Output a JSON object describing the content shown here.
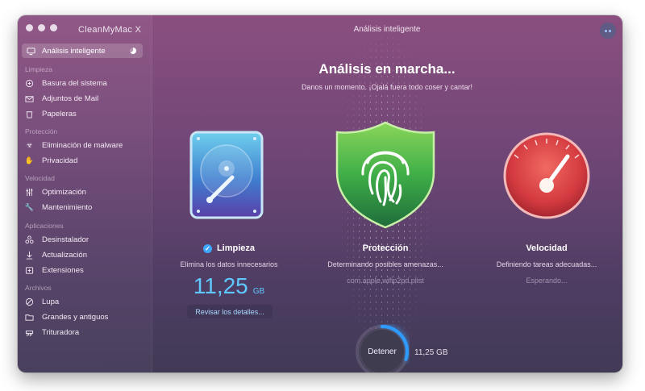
{
  "app": {
    "title": "CleanMyMac X",
    "window_title": "Análisis inteligente"
  },
  "sidebar": {
    "active": {
      "label": "Análisis inteligente",
      "icon": "monitor-icon"
    },
    "sections": [
      {
        "label": "Limpieza",
        "items": [
          {
            "label": "Basura del sistema",
            "icon": "system-junk-icon"
          },
          {
            "label": "Adjuntos de Mail",
            "icon": "mail-icon"
          },
          {
            "label": "Papeleras",
            "icon": "trash-icon"
          }
        ]
      },
      {
        "label": "Protección",
        "items": [
          {
            "label": "Eliminación de malware",
            "icon": "biohazard-icon"
          },
          {
            "label": "Privacidad",
            "icon": "hand-icon"
          }
        ]
      },
      {
        "label": "Velocidad",
        "items": [
          {
            "label": "Optimización",
            "icon": "sliders-icon"
          },
          {
            "label": "Mantenimiento",
            "icon": "wrench-icon"
          }
        ]
      },
      {
        "label": "Aplicaciones",
        "items": [
          {
            "label": "Desinstalador",
            "icon": "uninstaller-icon"
          },
          {
            "label": "Actualización",
            "icon": "update-icon"
          },
          {
            "label": "Extensiones",
            "icon": "extensions-icon"
          }
        ]
      },
      {
        "label": "Archivos",
        "items": [
          {
            "label": "Lupa",
            "icon": "lens-icon"
          },
          {
            "label": "Grandes y antiguos",
            "icon": "folder-icon"
          },
          {
            "label": "Trituradora",
            "icon": "shredder-icon"
          }
        ]
      }
    ]
  },
  "main": {
    "headline": "Análisis en marcha...",
    "subline": "Danos un momento. ¡Ojalá fuera todo coser y cantar!",
    "modules": [
      {
        "title": "Limpieza",
        "description": "Elimina los datos innecesarios",
        "icon": "hard-drive-icon",
        "done": true
      },
      {
        "title": "Protección",
        "description": "Determinando posibles amenazas...",
        "status": "com.apple.wifip2pd.plist",
        "icon": "fingerprint-shield-icon"
      },
      {
        "title": "Velocidad",
        "description": "Definiendo tareas adecuadas...",
        "status": "Esperando...",
        "icon": "speedometer-icon"
      }
    ],
    "cleanup_size": {
      "value": "11,25",
      "unit": "GB"
    },
    "review_button": "Revisar los detalles...",
    "stop_button": "Detener",
    "stop_size": "11,25 GB",
    "progress": 0.3
  },
  "colors": {
    "accent": "#3ea7ff",
    "size_text": "#5ec8ff",
    "shield": "#3fae48",
    "gauge": "#d9373f"
  }
}
